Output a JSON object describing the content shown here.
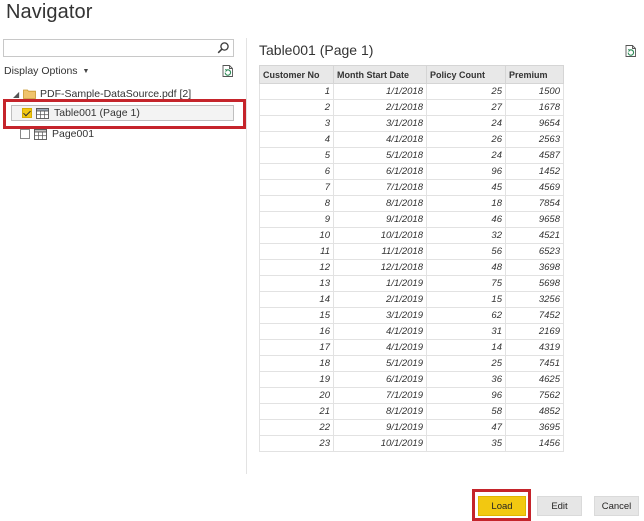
{
  "dialog": {
    "title": "Navigator"
  },
  "left_panel": {
    "search": {
      "value": "",
      "placeholder": ""
    },
    "display_options_label": "Display Options",
    "tree": {
      "folder": {
        "label": "PDF-Sample-DataSource.pdf [2]"
      },
      "items": [
        {
          "label": "Table001 (Page 1)",
          "checked": true,
          "selected": true
        },
        {
          "label": "Page001",
          "checked": false,
          "selected": false
        }
      ]
    }
  },
  "preview": {
    "title": "Table001 (Page 1)",
    "columns": [
      "Customer No",
      "Month Start Date",
      "Policy Count",
      "Premium"
    ],
    "rows": [
      [
        "1",
        "1/1/2018",
        "25",
        "1500"
      ],
      [
        "2",
        "2/1/2018",
        "27",
        "1678"
      ],
      [
        "3",
        "3/1/2018",
        "24",
        "9654"
      ],
      [
        "4",
        "4/1/2018",
        "26",
        "2563"
      ],
      [
        "5",
        "5/1/2018",
        "24",
        "4587"
      ],
      [
        "6",
        "6/1/2018",
        "96",
        "1452"
      ],
      [
        "7",
        "7/1/2018",
        "45",
        "4569"
      ],
      [
        "8",
        "8/1/2018",
        "18",
        "7854"
      ],
      [
        "9",
        "9/1/2018",
        "46",
        "9658"
      ],
      [
        "10",
        "10/1/2018",
        "32",
        "4521"
      ],
      [
        "11",
        "11/1/2018",
        "56",
        "6523"
      ],
      [
        "12",
        "12/1/2018",
        "48",
        "3698"
      ],
      [
        "13",
        "1/1/2019",
        "75",
        "5698"
      ],
      [
        "14",
        "2/1/2019",
        "15",
        "3256"
      ],
      [
        "15",
        "3/1/2019",
        "62",
        "7452"
      ],
      [
        "16",
        "4/1/2019",
        "31",
        "2169"
      ],
      [
        "17",
        "4/1/2019",
        "14",
        "4319"
      ],
      [
        "18",
        "5/1/2019",
        "25",
        "7451"
      ],
      [
        "19",
        "6/1/2019",
        "36",
        "4625"
      ],
      [
        "20",
        "7/1/2019",
        "96",
        "7562"
      ],
      [
        "21",
        "8/1/2019",
        "58",
        "4852"
      ],
      [
        "22",
        "9/1/2019",
        "47",
        "3695"
      ],
      [
        "23",
        "10/1/2019",
        "35",
        "1456"
      ]
    ]
  },
  "footer": {
    "load_label": "Load",
    "edit_label": "Edit",
    "cancel_label": "Cancel"
  },
  "colors": {
    "accent": "#f2c811",
    "highlight": "#c5242b"
  },
  "icons": {
    "search": "search-icon",
    "display_options_caret": "caret-down-icon",
    "refresh": "refresh-icon",
    "folder": "folder-icon",
    "table": "table-icon"
  }
}
